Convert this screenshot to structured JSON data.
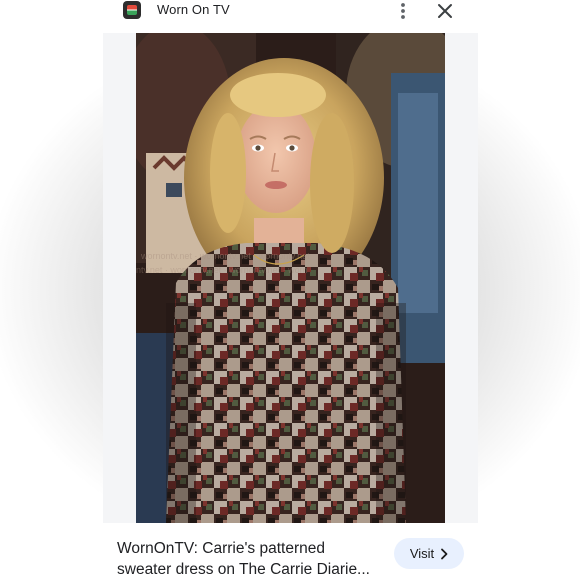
{
  "header": {
    "site_name": "Worn On TV"
  },
  "image": {
    "alt": "Carrie Bradshaw wearing a patterned sweater dress"
  },
  "footer": {
    "caption_line1": "WornOnTV: Carrie's patterned",
    "caption_line2": "sweater dress on The Carrie Diarie...",
    "visit_label": "Visit"
  },
  "colors": {
    "visit_bg": "#e8f0fe",
    "text": "#202124"
  },
  "icons": {
    "app": "worn-on-tv-app-icon",
    "more": "more-vertical-icon",
    "close": "close-icon",
    "visit_arrow": "chevron-right-icon"
  }
}
